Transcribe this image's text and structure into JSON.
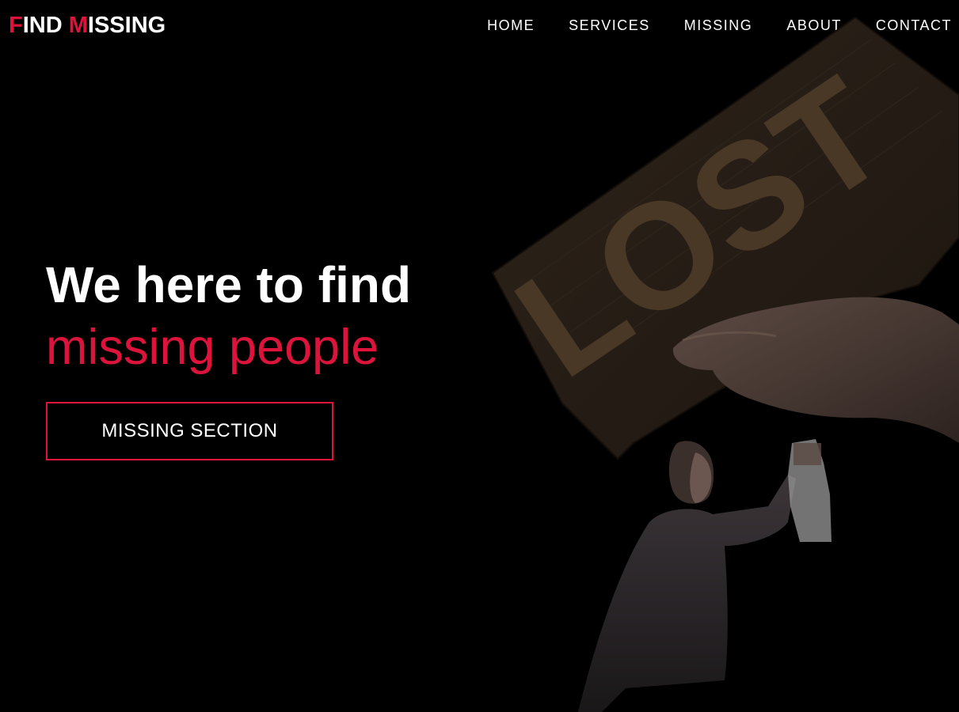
{
  "header": {
    "logo": {
      "word1_initial": "F",
      "word1_rest": "IND ",
      "word2_initial": "M",
      "word2_rest": "ISSING"
    },
    "nav": [
      {
        "label": "HOME"
      },
      {
        "label": "SERVICES"
      },
      {
        "label": "MISSING"
      },
      {
        "label": "ABOUT"
      },
      {
        "label": "CONTACT"
      }
    ]
  },
  "hero": {
    "title": "We here to find",
    "subtitle": "missing people",
    "cta_label": "MISSING SECTION",
    "sign_text": "LOST"
  },
  "colors": {
    "accent": "#dc143c",
    "background": "#000000",
    "text": "#ffffff"
  }
}
